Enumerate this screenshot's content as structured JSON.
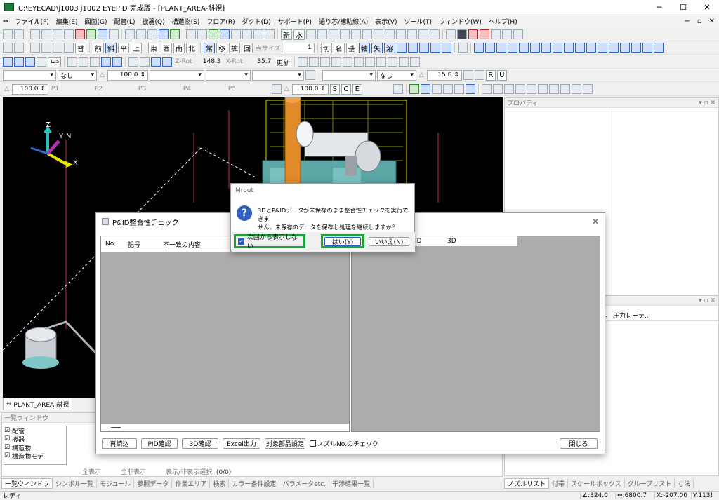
{
  "window": {
    "title": "C:\\EYECAD\\j1003 j1002 EYEPID 完成版 - [PLANT_AREA-斜視]",
    "minimize": "─",
    "maximize": "☐",
    "close": "✕"
  },
  "menu": [
    "ファイル(F)",
    "編集(E)",
    "図面(G)",
    "配管(L)",
    "機器(Q)",
    "構造物(S)",
    "フロア(R)",
    "ダクト(D)",
    "サポート(P)",
    "通り芯/補助線(A)",
    "表示(V)",
    "ツール(T)",
    "ウィンドウ(W)",
    "ヘルプ(H)"
  ],
  "mdi_controls": [
    "−",
    "▫",
    "✕"
  ],
  "toolbar2": {
    "chars": [
      "前",
      "斜",
      "平",
      "上",
      "東",
      "西",
      "南",
      "北",
      "常",
      "移",
      "拡",
      "回"
    ],
    "pointsize_label": "点サイズ",
    "pointsize_value": "1",
    "chars2": [
      "切",
      "名",
      "基",
      "軸",
      "矢",
      "溶"
    ]
  },
  "toolbar3": {
    "zrot_label": "Z-Rot",
    "zrot_value": "148.3",
    "xrot_label": "X-Rot",
    "xrot_value": "35.7",
    "update": "更新",
    "small_label": "125"
  },
  "toolbar4": {
    "none1": "なし",
    "value1": "100.0",
    "none2": "なし",
    "value2": "15.0",
    "r": "R",
    "u": "U"
  },
  "toolbar5": {
    "value1": "100.0",
    "p_labels": [
      "P1",
      "P2",
      "P3",
      "P4",
      "P5"
    ],
    "value2": "100.0",
    "sce": [
      "S",
      "C",
      "E"
    ]
  },
  "viewport": {
    "axis_z": "Z",
    "axis_y": "Y",
    "axis_n": "N",
    "axis_x": "X",
    "tab_label": "PLANT_AREA-斜視"
  },
  "property_panel": {
    "title": "プロパティ",
    "controls": "▾ ▫ ✕"
  },
  "right_lower_panel": {
    "controls": "▾ ▫ ✕",
    "col_dots": "..",
    "col_label": "圧力レーテ.."
  },
  "list_window": {
    "title": "一覧ウィンドウ",
    "tree": [
      "配管",
      "機器",
      "構造物",
      "構造物モデ"
    ],
    "show_all": "全表示",
    "hide_all": "全非表示",
    "toggle_select": "表示/非表示選択",
    "count": "(0/0)"
  },
  "bottom_tabs": [
    "一覧ウィンドウ",
    "シンボル一覧",
    "モジュール",
    "参照データ",
    "作業エリア",
    "検索",
    "カラー条件設定",
    "パラメータetc.",
    "干渉結果一覧"
  ],
  "right_tabs": [
    "ノズルリスト",
    "付帯",
    "スケールボックス",
    "グループリスト",
    "寸法"
  ],
  "status": {
    "ready": "レディ",
    "angle": "∠:324.0",
    "mm": "⇔:6800.7",
    "x": "X:-207.00",
    "y": "Y:113!"
  },
  "pid_dialog": {
    "title": "P&ID整合性チェック",
    "close": "✕",
    "left_columns": [
      "No.",
      "記号",
      "不一致の内容"
    ],
    "right_columns": [
      "ID",
      "3D"
    ],
    "buttons": [
      "再読込",
      "PID確認",
      "3D確認",
      "Excel出力",
      "対象部品設定"
    ],
    "nozzle_check_label": "ノズルNo.のチェック",
    "close_button": "閉じる"
  },
  "msg_dialog": {
    "title": "Mrout",
    "icon": "?",
    "line1": "3DとP&IDデータが未保存のまま整合性チェックを実行できま",
    "line2": "せん。未保存のデータを保存し処理を継続しますか？",
    "checkbox_label": "次回から表示しない",
    "checkbox_checked": true,
    "yes": "はい(Y)",
    "no": "いいえ(N)",
    "highlight_color": "#1aa33a",
    "accent": "#2f5fbf"
  }
}
